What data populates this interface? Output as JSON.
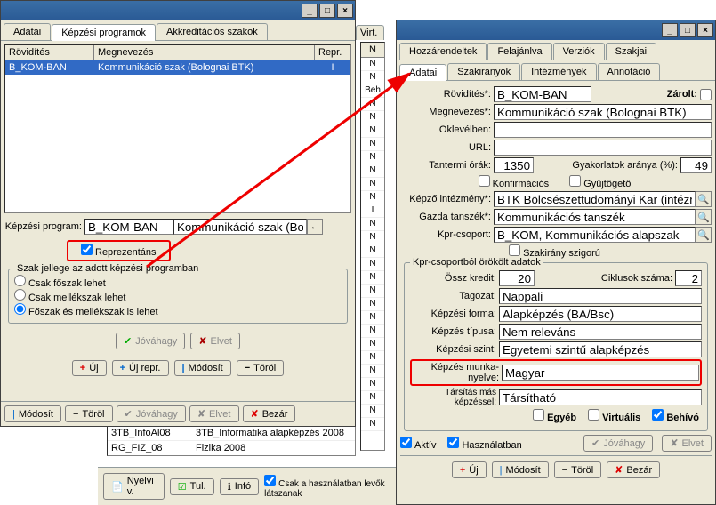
{
  "w1": {
    "tabs": [
      "Adatai",
      "Képzési programok",
      "Akkreditációs szakok"
    ],
    "active_tab": 1,
    "cols": [
      "Rövidítés",
      "Megnevezés",
      "Repr."
    ],
    "row": [
      "B_KOM-BAN",
      "Kommunikáció szak (Bolognai BTK)",
      "I"
    ],
    "kepzesi_label": "Képzési program:",
    "kepzesi_val1": "B_KOM-BAN",
    "kepzesi_val2": "Kommunikáció szak (Bolognai",
    "reprezentans": "Reprezentáns",
    "group_title": "Szak jellege az adott képzési programban",
    "radios": [
      "Csak főszak lehet",
      "Csak mellékszak lehet",
      "Főszak és mellékszak is lehet"
    ],
    "btns1": [
      "Jóváhagy",
      "Elvet"
    ],
    "btns2": [
      "Új",
      "Új repr.",
      "Módosít",
      "Töröl"
    ],
    "btns3": [
      "Módosít",
      "Töröl",
      "Jóváhagy",
      "Elvet",
      "Bezár"
    ]
  },
  "mid": {
    "tab": "Virt.",
    "ncol": [
      "N",
      "N",
      "Beh",
      "N",
      "N",
      "N",
      "N",
      "N",
      "N",
      "N",
      "N",
      "I",
      "N",
      "N",
      "N",
      "N",
      "N",
      "N",
      "N",
      "N",
      "N",
      "N",
      "N",
      "N",
      "N",
      "N",
      "N",
      "N"
    ]
  },
  "bottom_rows": [
    [
      "3TB_InfoAl08",
      "3TB_Informatika alapképzés 2008"
    ],
    [
      "RG_FIZ_08",
      "Fizika 2008"
    ]
  ],
  "footer": {
    "btns": [
      "Nyelvi v.",
      "Tul.",
      "Infó"
    ],
    "note": "Csak a használatban levők látszanak"
  },
  "w2": {
    "tabs_top": [
      "Hozzárendeltek",
      "Felajánlva",
      "Verziók",
      "Szakjai"
    ],
    "tabs_bot": [
      "Adatai",
      "Szakirányok",
      "Intézmények",
      "Annotáció"
    ],
    "fields": {
      "rovidites_l": "Rövidítés*:",
      "rovidites_v": "B_KOM-BAN",
      "zarolt_l": "Zárolt:",
      "megnevezes_l": "Megnevezés*:",
      "megnevezes_v": "Kommunikáció szak (Bolognai BTK)",
      "oklevelben_l": "Oklevélben:",
      "url_l": "URL:",
      "tantermi_l": "Tantermi órák:",
      "tantermi_v": "1350",
      "gyak_l": "Gyakorlatok aránya (%):",
      "gyak_v": "49",
      "konf": "Konfirmációs",
      "gyujt": "Gyűjtögető",
      "kepzo_l": "Képző intézmény*:",
      "kepzo_v": "BTK Bölcsészettudományi Kar (intézmény",
      "gazda_l": "Gazda tanszék*:",
      "gazda_v": "Kommunikációs tanszék",
      "kpr_l": "Kpr-csoport:",
      "kpr_v": "B_KOM, Kommunikációs alapszak",
      "szakirany": "Szakirány szigorú"
    },
    "group2_title": "Kpr-csoportból örökölt adatok",
    "g2": {
      "ossz_l": "Össz kredit:",
      "ossz_v": "20",
      "cikl_l": "Ciklusok száma:",
      "cikl_v": "2",
      "tagozat_l": "Tagozat:",
      "tagozat_v": "Nappali",
      "forma_l": "Képzési forma:",
      "forma_v": "Alapképzés (BA/Bsc)",
      "tipus_l": "Képzés típusa:",
      "tipus_v": "Nem releváns",
      "szint_l": "Képzési szint:",
      "szint_v": "Egyetemi szintű alapképzés",
      "nyelv_l": "Képzés munka-nyelve:",
      "nyelv_v": "Magyar",
      "tarsit_l": "Társítás más képzéssel:",
      "tarsit_v": "Társítható",
      "egyeb": "Egyéb",
      "virtualis": "Virtuális",
      "behivo": "Behívó"
    },
    "aktiv": "Aktív",
    "haszn": "Használatban",
    "btns1": [
      "Jóváhagy",
      "Elvet"
    ],
    "btns2": [
      "Új",
      "Módosít",
      "Töröl",
      "Bezár"
    ]
  }
}
